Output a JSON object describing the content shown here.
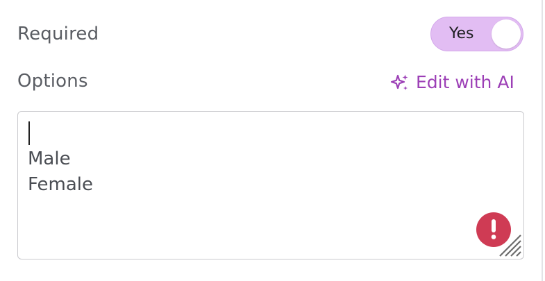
{
  "required": {
    "label": "Required",
    "toggle_text": "Yes",
    "value": true
  },
  "options": {
    "label": "Options",
    "edit_ai_label": "Edit with AI",
    "lines": [
      "Male",
      "Female"
    ]
  },
  "colors": {
    "toggle_bg": "#e2bdf3",
    "accent": "#9c3fb6",
    "error": "#cf3b54",
    "label": "#5a5d63"
  },
  "icons": {
    "edit_ai": "sparkle-icon",
    "error": "exclamation-icon",
    "resize": "resize-handle-icon"
  }
}
